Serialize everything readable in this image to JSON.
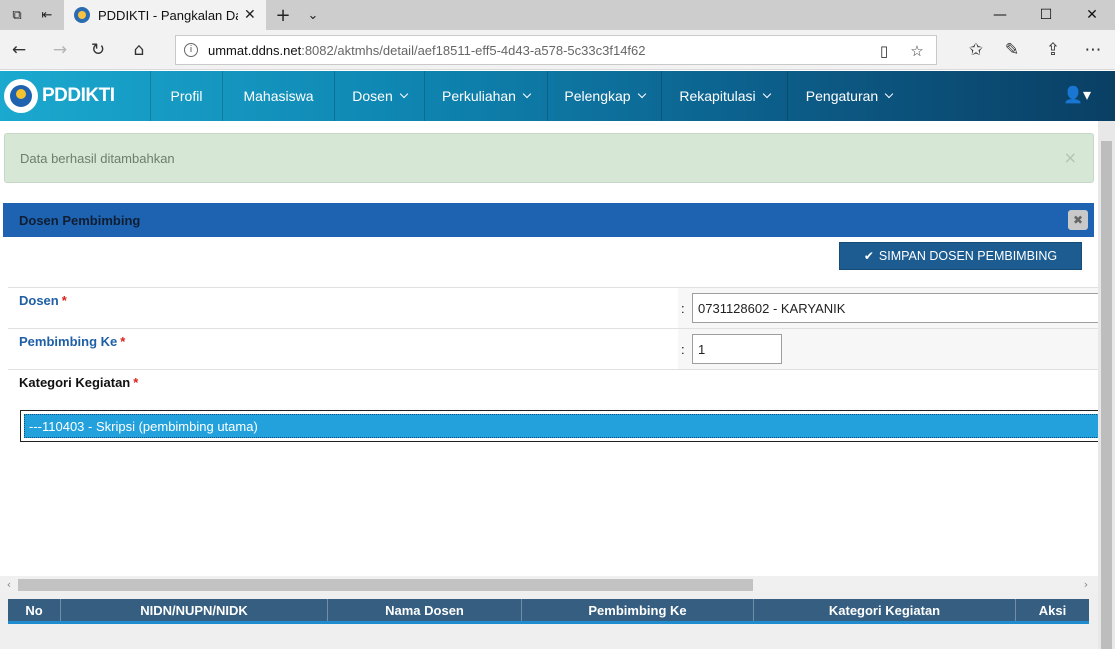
{
  "browser": {
    "tab_title": "PDDIKTI - Pangkalan Da",
    "url_host": "ummat.ddns.net",
    "url_path": ":8082/aktmhs/detail/aef18511-eff5-4d43-a578-5c33c3f14f62"
  },
  "navbar": {
    "brand": "PDDIKTI",
    "items": [
      "Profil",
      "Mahasiswa",
      "Dosen",
      "Perkuliahan",
      "Pelengkap",
      "Rekapitulasi",
      "Pengaturan"
    ]
  },
  "alert": {
    "message": "Data berhasil ditambahkan",
    "close": "×"
  },
  "panel": {
    "title": "Dosen Pembimbing",
    "close": "✖",
    "save_button": "SIMPAN DOSEN PEMBIMBING"
  },
  "form": {
    "colon": ":",
    "required_mark": "*",
    "dosen_label": "Dosen",
    "dosen_value": "0731128602 - KARYANIK",
    "pembimbing_label": "Pembimbing Ke",
    "pembimbing_value": "1",
    "kategori_label": "Kategori Kegiatan",
    "kategori_selected": "---110403 - Skripsi (pembimbing utama)"
  },
  "table": {
    "headers": [
      "No",
      "NIDN/NUPN/NIDK",
      "Nama Dosen",
      "Pembimbing Ke",
      "Kategori Kegiatan",
      "Aksi"
    ]
  },
  "colors": {
    "panel_header": "#1e63b2",
    "save_button": "#1d5c91",
    "selected_option": "#22a1dd",
    "table_header": "#355e80",
    "alert_bg": "#d6e7d6"
  }
}
